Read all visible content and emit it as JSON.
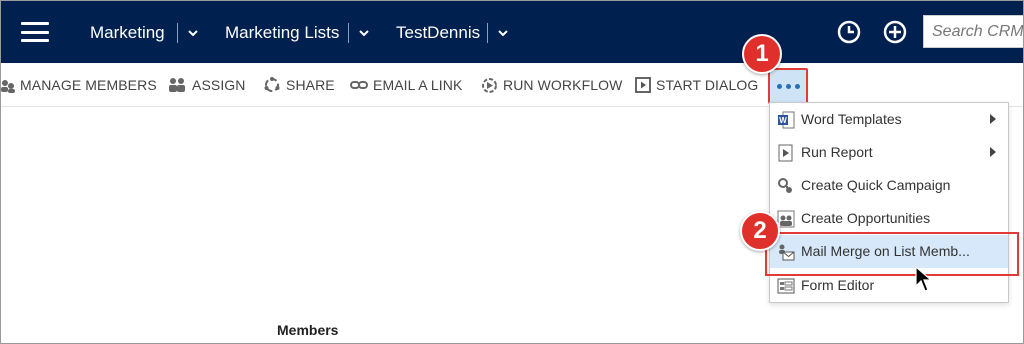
{
  "nav": {
    "breadcrumbs": [
      "Marketing",
      "Marketing Lists",
      "TestDennis"
    ],
    "search_placeholder": "Search CRM d",
    "icons": [
      "hamburger-menu-icon",
      "history-clock-icon",
      "add-plus-icon"
    ]
  },
  "command_bar": {
    "items": [
      {
        "label": "MANAGE MEMBERS",
        "icon": "manage-members-icon"
      },
      {
        "label": "ASSIGN",
        "icon": "assign-icon"
      },
      {
        "label": "SHARE",
        "icon": "share-icon"
      },
      {
        "label": "EMAIL A LINK",
        "icon": "email-link-icon"
      },
      {
        "label": "RUN WORKFLOW",
        "icon": "run-workflow-icon"
      },
      {
        "label": "START DIALOG",
        "icon": "start-dialog-icon"
      }
    ],
    "more_icon": "ellipsis-icon"
  },
  "menu": {
    "items": [
      {
        "label": "Word Templates",
        "icon": "word-templates-icon",
        "submenu": true
      },
      {
        "label": "Run Report",
        "icon": "run-report-icon",
        "submenu": true
      },
      {
        "label": "Create Quick Campaign",
        "icon": "quick-campaign-icon",
        "submenu": false
      },
      {
        "label": "Create Opportunities",
        "icon": "opportunities-icon",
        "submenu": false
      },
      {
        "label": "Mail Merge on List Memb...",
        "icon": "mail-merge-icon",
        "submenu": false,
        "highlighted": true
      },
      {
        "label": "Form Editor",
        "icon": "form-editor-icon",
        "submenu": false
      }
    ]
  },
  "callouts": [
    "1",
    "2"
  ],
  "section": {
    "members_label": "Members"
  },
  "colors": {
    "nav_bg": "#002050",
    "highlight": "#d6e8f9",
    "callout_red": "#e0302b",
    "accent_blue": "#2a6db5"
  }
}
